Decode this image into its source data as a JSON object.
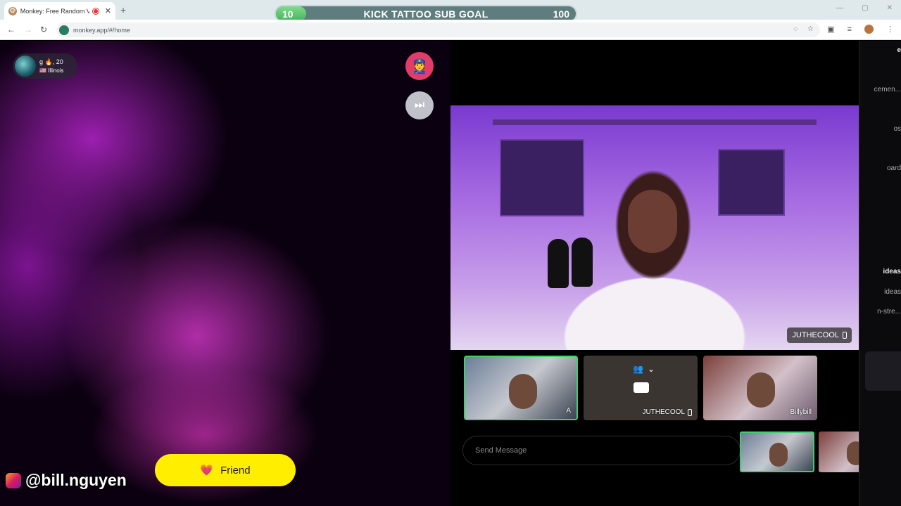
{
  "browser": {
    "tab_title": "Monkey: Free Random Vide",
    "new_tab": "+",
    "url": "monkey.app/#/home",
    "back_icon": "arrow-left-icon",
    "forward_icon": "arrow-right-icon",
    "reload_icon": "reload-icon"
  },
  "goal": {
    "current": "10",
    "label": "KICK TATTOO SUB GOAL",
    "target": "100",
    "progress_fraction": 0.1
  },
  "self_view": {
    "user_name": "g 🔥, 20",
    "user_location": "🇺🇸 Illinois",
    "friend_label": "Friend",
    "social_handle": "@bill.nguyen"
  },
  "main_video": {
    "streamer_tag": "JUTHECOOL"
  },
  "thumbnails": [
    {
      "label": "A"
    },
    {
      "label": "JUTHECOOL"
    },
    {
      "label": "Billybill"
    }
  ],
  "chat": {
    "placeholder": "Send Message"
  },
  "side_panel": {
    "snippets": [
      "e",
      "cemen...",
      "os",
      "oard",
      "ideas",
      "ideas",
      "n-stre..."
    ]
  },
  "colors": {
    "goal_fill": "#46b35a",
    "friend_button": "#ffee00",
    "active_border": "#3ed070",
    "police_button": "#e33b6a"
  }
}
